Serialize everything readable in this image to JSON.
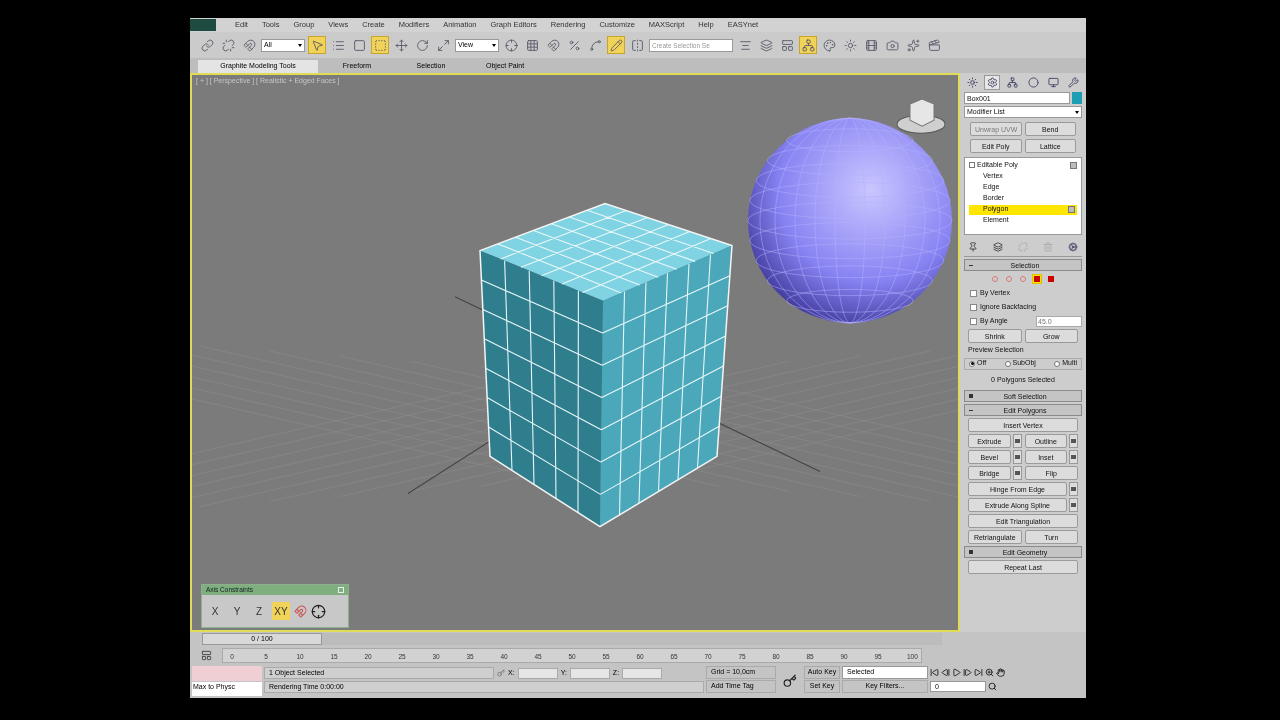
{
  "menu": [
    "Edit",
    "Tools",
    "Group",
    "Views",
    "Create",
    "Modifiers",
    "Animation",
    "Graph Editors",
    "Rendering",
    "Customize",
    "MAXScript",
    "Help",
    "EASYnet"
  ],
  "toolbar": [
    {
      "kind": "tool",
      "active": false
    },
    {
      "kind": "tool",
      "active": false
    },
    {
      "kind": "tool",
      "active": false
    },
    {
      "kind": "dropdown",
      "value": "All"
    },
    {
      "kind": "tool",
      "active": true
    },
    {
      "kind": "tool",
      "active": false
    },
    {
      "kind": "tool",
      "active": false
    },
    {
      "kind": "tool",
      "active": true
    },
    {
      "kind": "tool",
      "active": false
    },
    {
      "kind": "tool",
      "active": false
    },
    {
      "kind": "tool",
      "active": false
    },
    {
      "kind": "dropdown",
      "value": "View"
    },
    {
      "kind": "tool",
      "active": false
    },
    {
      "kind": "tool",
      "active": false
    },
    {
      "kind": "tool",
      "active": false
    },
    {
      "kind": "tool",
      "active": false
    },
    {
      "kind": "tool",
      "active": false
    },
    {
      "kind": "tool",
      "active": true
    },
    {
      "kind": "tool",
      "active": false
    },
    {
      "kind": "field",
      "placeholder": "Create Selection Se"
    },
    {
      "kind": "tool",
      "active": false
    },
    {
      "kind": "tool",
      "active": false
    },
    {
      "kind": "tool",
      "active": false
    },
    {
      "kind": "tool",
      "active": true
    },
    {
      "kind": "tool",
      "active": false
    },
    {
      "kind": "tool",
      "active": false
    },
    {
      "kind": "tool",
      "active": false
    },
    {
      "kind": "tool",
      "active": false
    },
    {
      "kind": "tool",
      "active": false
    },
    {
      "kind": "tool",
      "active": false
    }
  ],
  "ribbon_tabs": [
    {
      "label": "Graphite Modeling Tools",
      "selected": true
    },
    {
      "label": "Freeform",
      "selected": false
    },
    {
      "label": "Selection",
      "selected": false
    },
    {
      "label": "Object Paint",
      "selected": false
    }
  ],
  "viewport": {
    "label": "[ + ] [ Perspective ] [ Realistic + Edged Faces ]",
    "axis_constraints": {
      "title": "Axis Constraints",
      "buttons": [
        {
          "label": "X",
          "selected": false
        },
        {
          "label": "Y",
          "selected": false
        },
        {
          "label": "Z",
          "selected": false
        },
        {
          "label": "XY",
          "selected": true
        }
      ]
    }
  },
  "command_panel": {
    "tabs": [
      {
        "selected": false
      },
      {
        "selected": true
      },
      {
        "selected": false
      },
      {
        "selected": false
      },
      {
        "selected": false
      },
      {
        "selected": false
      }
    ],
    "object_name": "Box001",
    "modifier_list": "Modifier List",
    "modifier_buttons": [
      {
        "label": "Unwrap UVW",
        "disabled": true
      },
      {
        "label": "Bend",
        "disabled": false
      },
      {
        "label": "Edit Poly",
        "disabled": false
      },
      {
        "label": "Lattice",
        "disabled": false
      }
    ],
    "stack": {
      "label": "Editable Poly",
      "children": [
        {
          "label": "Vertex",
          "selected": false
        },
        {
          "label": "Edge",
          "selected": false
        },
        {
          "label": "Border",
          "selected": false
        },
        {
          "label": "Polygon",
          "selected": true
        },
        {
          "label": "Element",
          "selected": false
        }
      ]
    },
    "selection": {
      "title": "Selection",
      "levels": [
        {
          "selected": false
        },
        {
          "selected": false
        },
        {
          "selected": false
        },
        {
          "selected": true
        },
        {
          "selected": false
        }
      ],
      "checkboxes": [
        {
          "label": "By Vertex",
          "checked": false
        },
        {
          "label": "Ignore Backfacing",
          "checked": false
        },
        {
          "label": "By Angle",
          "checked": false
        }
      ],
      "angle": "45.0",
      "shrink": "Shrink",
      "grow": "Grow",
      "preview_title": "Preview Selection",
      "preview": [
        {
          "label": "Off",
          "selected": true
        },
        {
          "label": "SubObj",
          "selected": false
        },
        {
          "label": "Multi",
          "selected": false
        }
      ],
      "status": "0 Polygons Selected"
    },
    "soft_selection": "Soft Selection",
    "edit_polygons": "Edit Polygons",
    "edit_polygon_rows": [
      [
        {
          "label": "Insert Vertex",
          "settings": false
        }
      ],
      [
        {
          "label": "Extrude",
          "settings": true
        },
        {
          "label": "Outline",
          "settings": true
        }
      ],
      [
        {
          "label": "Bevel",
          "settings": true
        },
        {
          "label": "Inset",
          "settings": true
        }
      ],
      [
        {
          "label": "Bridge",
          "settings": true
        },
        {
          "label": "Flip",
          "settings": false
        }
      ],
      [
        {
          "label": "Hinge From Edge",
          "settings": true
        }
      ],
      [
        {
          "label": "Extrude Along Spline",
          "settings": true
        }
      ],
      [
        {
          "label": "Edit Triangulation",
          "settings": false
        }
      ],
      [
        {
          "label": "Retriangulate",
          "settings": false
        },
        {
          "label": "Turn",
          "settings": false
        }
      ]
    ],
    "edit_geometry": "Edit Geometry",
    "repeat_last": "Repeat Last"
  },
  "timeline": {
    "slider": "0 / 100",
    "level": 0,
    "ticks": [
      "0",
      "5",
      "10",
      "15",
      "20",
      "25",
      "30",
      "35",
      "40",
      "45",
      "50",
      "55",
      "60",
      "65",
      "70",
      "75",
      "80",
      "85",
      "90",
      "95",
      "100"
    ]
  },
  "status_bar": {
    "listener": "Max to Physc",
    "selected": "1 Object Selected",
    "render_time": "Rendering Time  0:00:00",
    "x_label": "X:",
    "y_label": "Y:",
    "z_label": "Z:",
    "grid": "Grid = 10,0cm",
    "time_tag": "Add Time Tag",
    "auto_key": "Auto Key",
    "key_mode": "Selected",
    "set_key": "Set Key",
    "key_filters": "Key Filters...",
    "frame": "0"
  }
}
